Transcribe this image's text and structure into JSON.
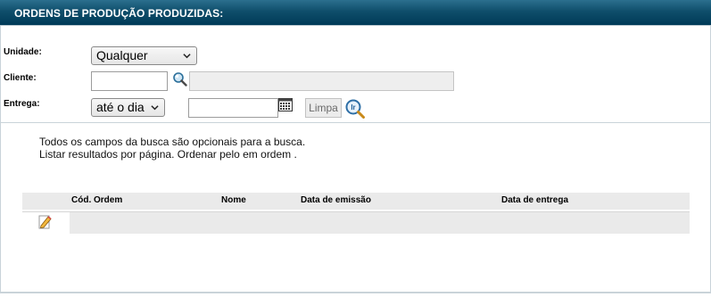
{
  "header": {
    "title": "ORDENS DE PRODUÇÃO PRODUZIDAS:"
  },
  "form": {
    "unidade_label": "Unidade:",
    "unidade_value": "Qualquer",
    "cliente_label": "Cliente:",
    "cliente_code_value": "",
    "cliente_name_value": "",
    "entrega_label": "Entrega:",
    "entrega_mode_value": "até o dia",
    "entrega_date_value": "",
    "limpa_label": "Limpa"
  },
  "info": {
    "line1": "Todos os campos da busca são opcionais para a busca.",
    "line2": "Listar resultados por página. Ordenar pelo em ordem ."
  },
  "table": {
    "columns": [
      "Cód. Ordem",
      "Nome",
      "Data de emissão",
      "Data de entrega"
    ],
    "rows": [
      {
        "cod": "",
        "nome": "",
        "emissao": "",
        "entrega": ""
      }
    ]
  },
  "icons": {
    "cliente_search": "magnifier-icon",
    "calendar": "calendar-icon",
    "go": "ir-search-icon",
    "edit": "pencil-edit-icon"
  }
}
